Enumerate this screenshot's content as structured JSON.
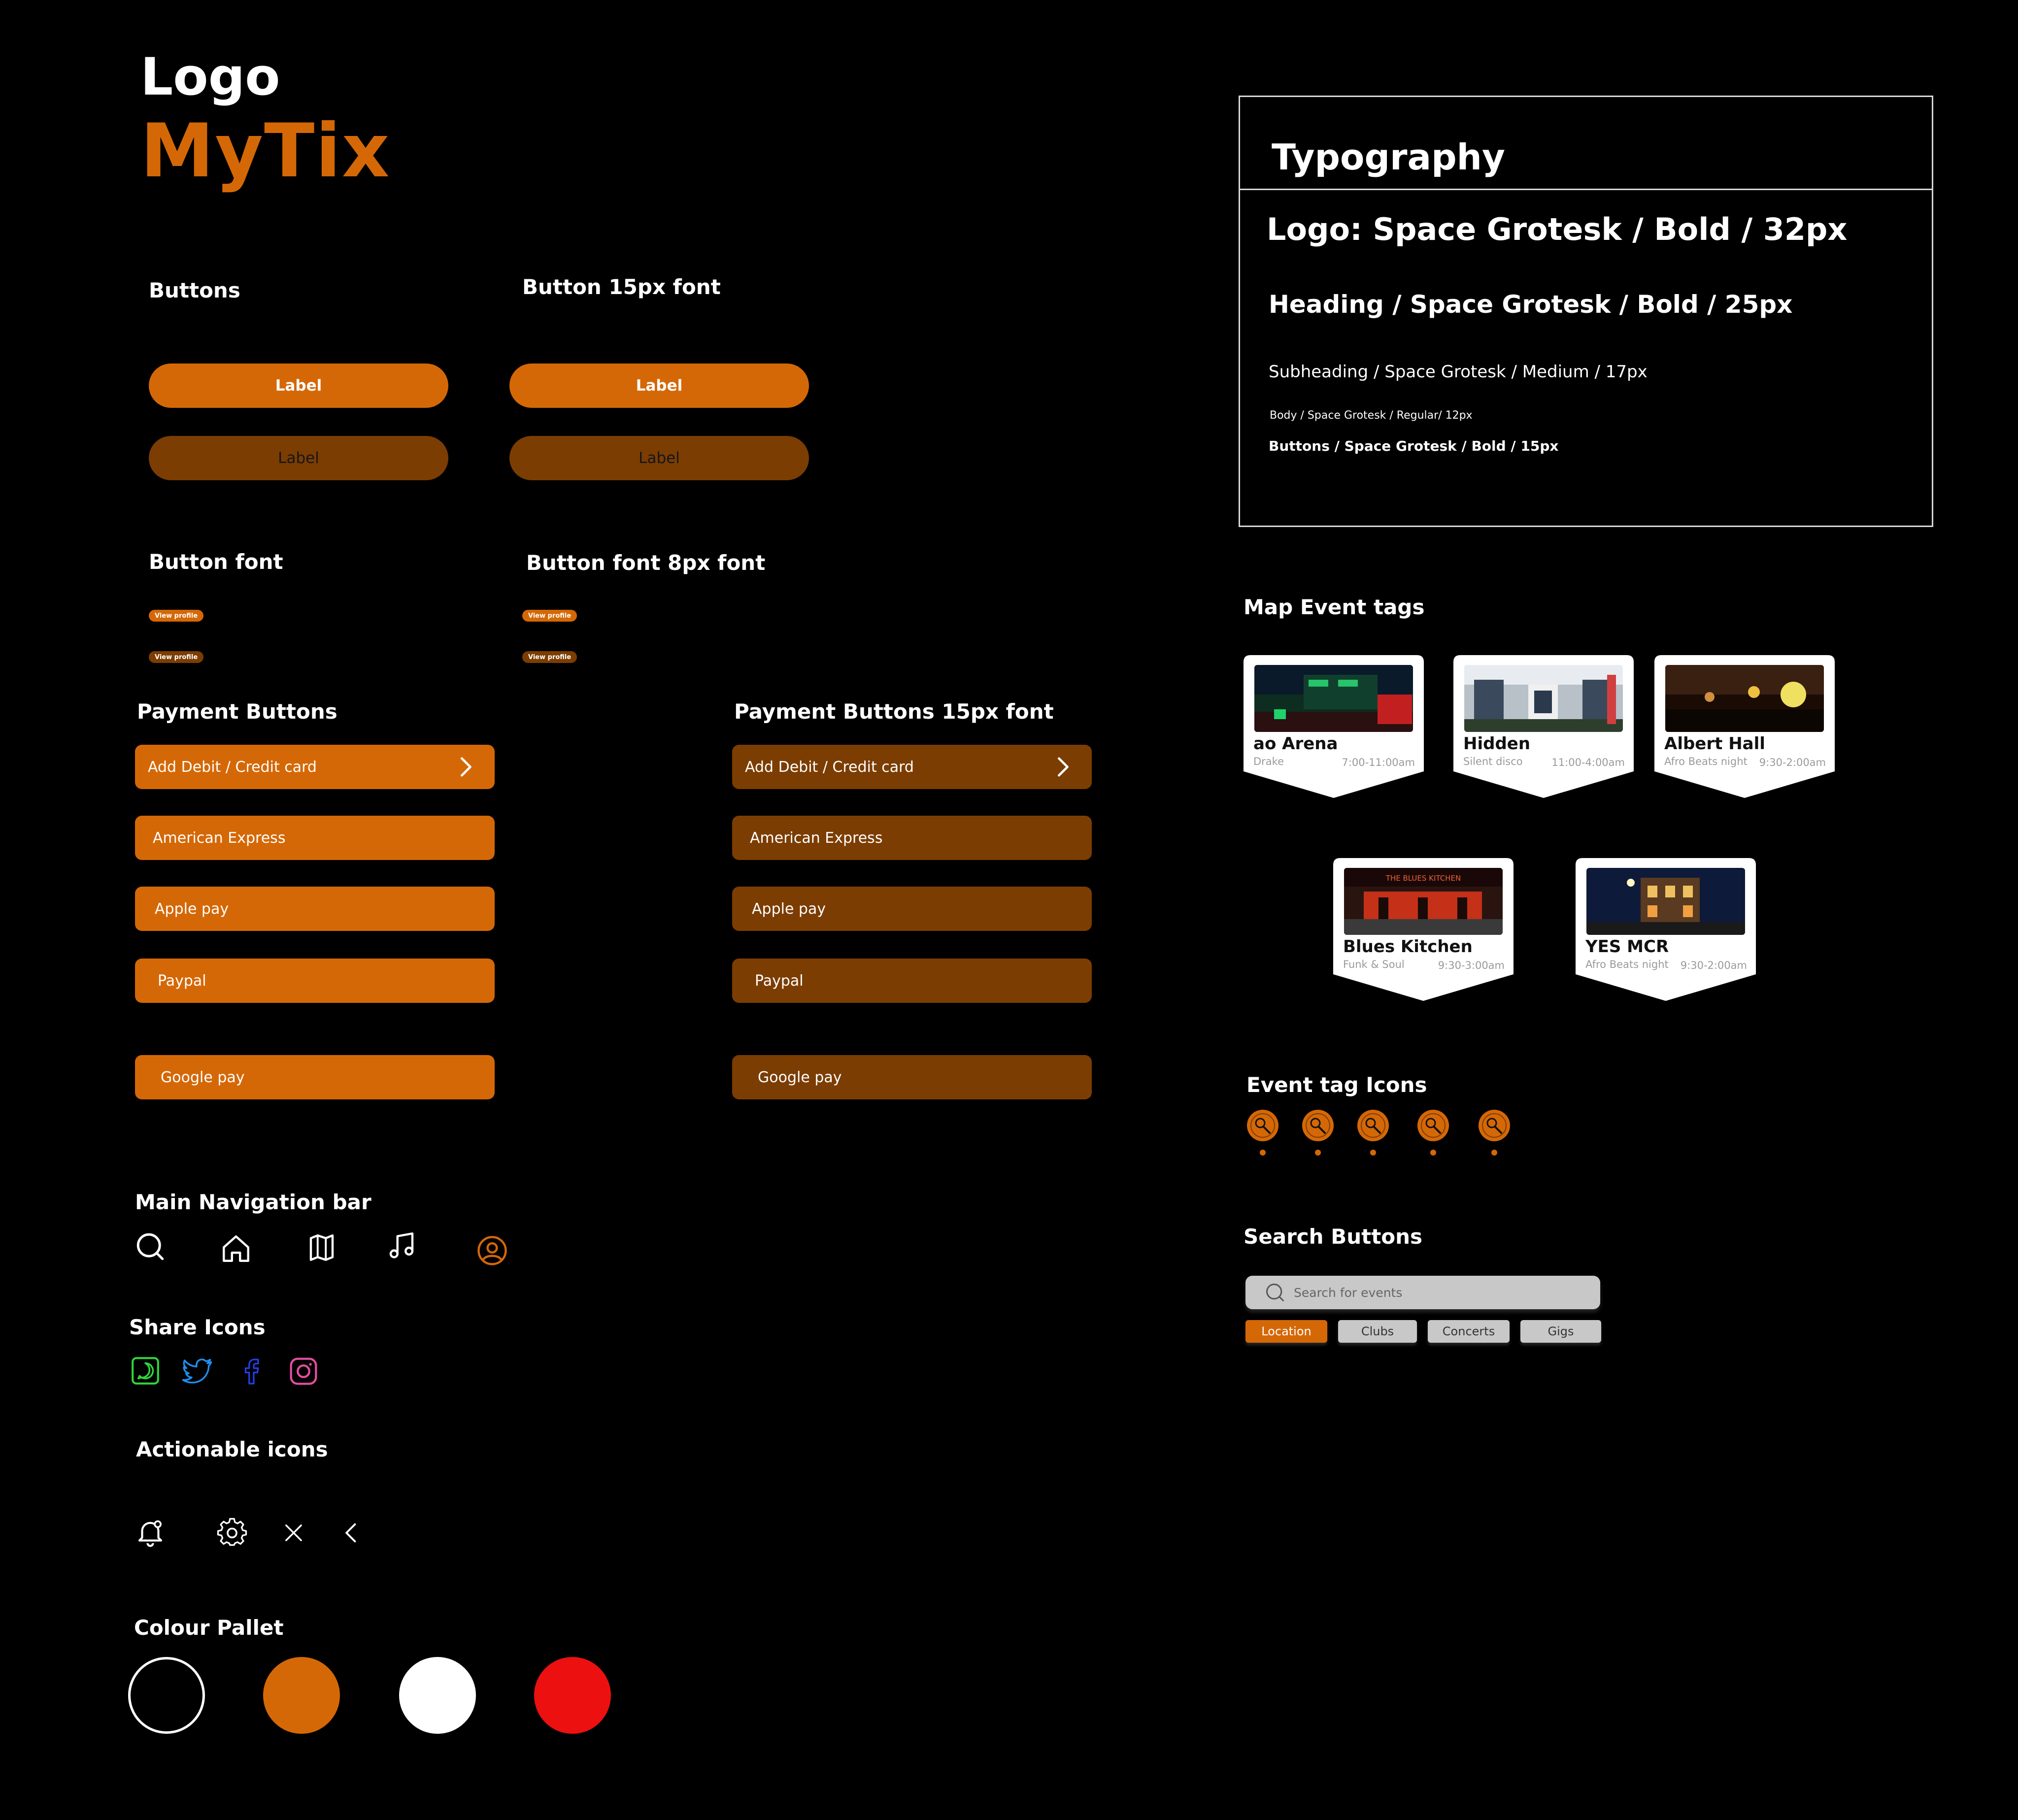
{
  "logo": {
    "heading": "Logo",
    "brand": "MyTix"
  },
  "buttons": {
    "heading": "Buttons",
    "heading_15px": "Button 15px font",
    "primary_label": "Label",
    "secondary_label": "Label"
  },
  "button_font": {
    "heading": "Button font",
    "heading_8px": "Button font 8px font",
    "mini_label": "View profile"
  },
  "payment": {
    "heading": "Payment Buttons",
    "heading_15px": "Payment Buttons 15px font",
    "items": [
      "Add Debit / Credit card",
      "American Express",
      "Apple pay",
      "Paypal",
      "Google pay"
    ]
  },
  "navigation": {
    "heading": "Main Navigation bar",
    "icons": [
      "search-icon",
      "home-icon",
      "map-icon",
      "music-icon",
      "profile-icon"
    ]
  },
  "share": {
    "heading": "Share Icons",
    "icons": [
      "whatsapp-icon",
      "twitter-icon",
      "facebook-icon",
      "instagram-icon"
    ]
  },
  "actionable": {
    "heading": "Actionable icons",
    "icons": [
      "notification-bell-icon",
      "settings-gear-icon",
      "close-icon",
      "back-chevron-icon"
    ]
  },
  "palette": {
    "heading": "Colour Pallet",
    "colors": [
      "#000000",
      "#d56806",
      "#ffffff",
      "#ec1010"
    ]
  },
  "typography": {
    "heading": "Typography",
    "logo": "Logo: Space Grotesk / Bold / 32px",
    "heading_style": "Heading / Space Grotesk / Bold / 25px",
    "subheading": "Subheading / Space Grotesk / Medium / 17px",
    "body": "Body / Space Grotesk / Regular/ 12px",
    "buttons": "Buttons / Space Grotesk / Bold / 15px"
  },
  "map_tags": {
    "heading": "Map Event  tags",
    "events": [
      {
        "name": "ao Arena",
        "sub": "Drake",
        "time": "7:00-11:00am"
      },
      {
        "name": "Hidden",
        "sub": "Silent disco",
        "time": "11:00-4:00am"
      },
      {
        "name": "Albert Hall",
        "sub": "Afro Beats night",
        "time": "9:30-2:00am"
      },
      {
        "name": "Blues Kitchen",
        "sub": "Funk & Soul",
        "time": "9:30-3:00am",
        "sign": "THE BLUES KITCHEN"
      },
      {
        "name": "YES MCR",
        "sub": "Afro Beats night",
        "time": "9:30-2:00am"
      }
    ]
  },
  "event_icons": {
    "heading": "Event tag Icons",
    "icon": "microphone-pin-icon"
  },
  "search": {
    "heading": "Search Buttons",
    "placeholder": "Search for events",
    "chips": [
      "Location",
      "Clubs",
      "Concerts",
      "Gigs"
    ],
    "active_chip": "Location"
  },
  "colors": {
    "accent": "#d56806",
    "accent_dark": "#7c3d02",
    "background": "#000000"
  }
}
